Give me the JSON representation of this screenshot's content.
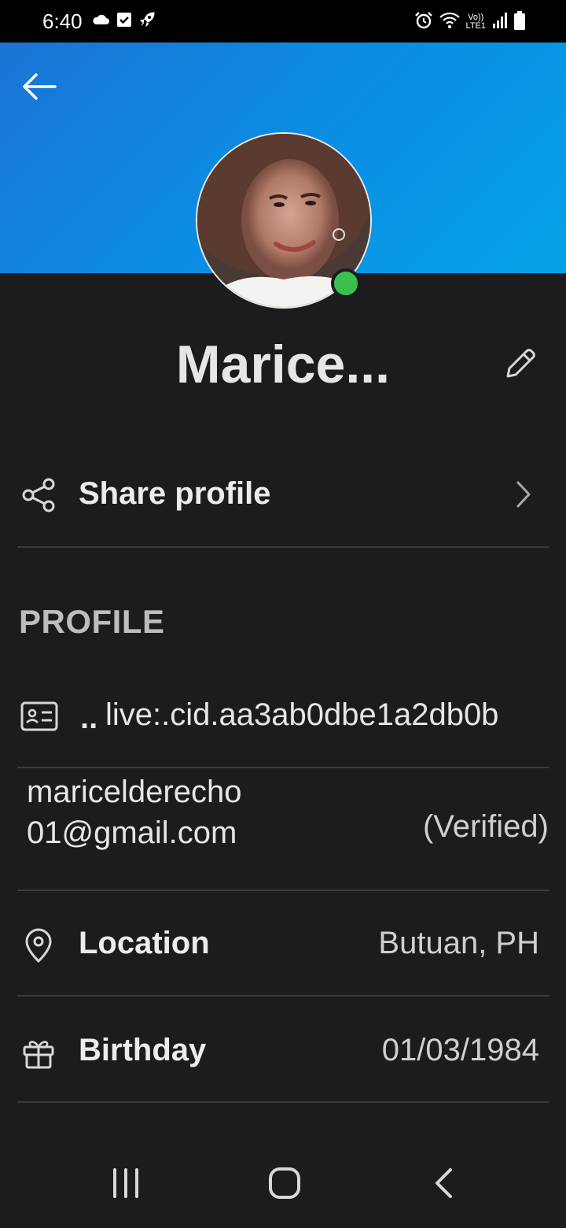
{
  "status_bar": {
    "time": "6:40",
    "left_icons": [
      "cloud-icon",
      "checkbox-icon",
      "rocket-icon"
    ],
    "right_icons": [
      "alarm-icon",
      "wifi-icon",
      "volte-icon",
      "signal-icon",
      "battery-icon"
    ],
    "volte_top": "Vo))",
    "volte_bottom": "LTE1"
  },
  "header": {
    "back_icon": "arrow-left-icon",
    "banner_color_start": "#1a74d6",
    "banner_color_end": "#05a2e6"
  },
  "profile": {
    "name": "Marice...",
    "online_status_color": "#3ac14b",
    "edit_icon": "pencil-icon"
  },
  "share": {
    "label": "Share profile",
    "icon": "share-icon"
  },
  "section": {
    "title": "PROFILE"
  },
  "id_row": {
    "prefix": "..",
    "value": "live:.cid.aa3ab0dbe1a2db0b"
  },
  "email_row": {
    "value": "mariceldereсho01@gmail.com",
    "status": "(Verified)"
  },
  "location_row": {
    "label": "Location",
    "value": "Butuan, PH"
  },
  "birthday_row": {
    "label": "Birthday",
    "value": "01/03/1984"
  },
  "nav_bar": {
    "buttons": [
      "recent-apps-icon",
      "home-icon",
      "back-icon"
    ]
  }
}
